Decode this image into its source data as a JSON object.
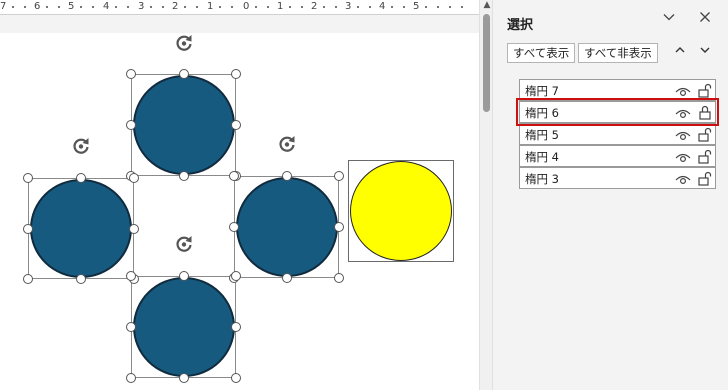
{
  "ruler": {
    "labels": [
      "7",
      "6",
      "5",
      "4",
      "3",
      "2",
      "1",
      "0",
      "1",
      "2",
      "3",
      "4",
      "5"
    ]
  },
  "pane": {
    "title": "選択",
    "collapse_icon": "chevron-down-icon",
    "close_icon": "close-icon",
    "show_all_label": "すべて表示",
    "hide_all_label": "すべて非表示",
    "bring_forward_icon": "chevron-up-icon",
    "send_backward_icon": "chevron-down-icon",
    "items": [
      {
        "label": "楕円 7",
        "visible": true,
        "locked": false,
        "selected": false
      },
      {
        "label": "楕円 6",
        "visible": true,
        "locked": true,
        "selected": true
      },
      {
        "label": "楕円 5",
        "visible": true,
        "locked": false,
        "selected": false
      },
      {
        "label": "楕円 4",
        "visible": true,
        "locked": false,
        "selected": false
      },
      {
        "label": "楕円 3",
        "visible": true,
        "locked": false,
        "selected": false
      }
    ]
  },
  "colors": {
    "circle_fill": "#175a80",
    "circle_highlight": "#ffff00",
    "selection_outline": "#cc1010"
  }
}
